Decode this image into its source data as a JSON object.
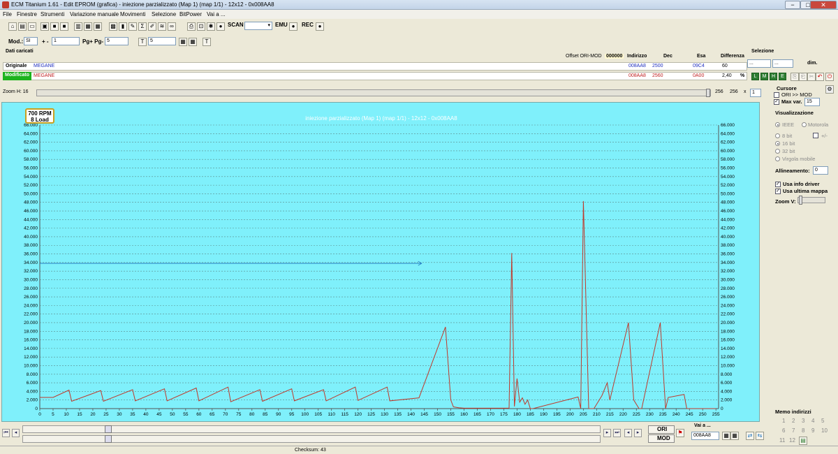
{
  "window": {
    "title": "ECM Titanium 1.61 - Edit EPROM (grafica) - iniezione parzializzato (Map 1) (map 1/1) - 12x12 - 0x008AA8",
    "minimize": "−",
    "maximize": "□",
    "close": "✕"
  },
  "menu": [
    "File",
    "Finestre",
    "Strumenti",
    "Variazione manuale",
    "Movimenti",
    "Selezione",
    "BitPower",
    "Vai a ..."
  ],
  "toolbar": {
    "scan_label": "SCAN",
    "emu_label": "EMU",
    "rec_label": "REC",
    "mod_label": "Mod.:",
    "mod_value": "SI",
    "plusminus_label": "+ -",
    "step_value": "1",
    "pg_label": "Pg+ Pg-",
    "pg_value": "5",
    "t_value": "5"
  },
  "data_panel": {
    "header": "Dati caricati",
    "offset_label": "Offset ORI-MOD",
    "offset_value": "000000",
    "col_indirizzo": "Indirizzo",
    "col_dec": "Dec",
    "col_esa": "Esa",
    "col_differenza": "Differenza",
    "originale_label": "Originale",
    "originale_name": "MEGANE",
    "originale_addr": "008AA8",
    "originale_dec": "2500",
    "originale_esa": "09C4",
    "originale_diff": "60",
    "modificato_label": "Modificato",
    "modificato_name": "MEGANE",
    "modificato_addr": "008AA8",
    "modificato_dec": "2560",
    "modificato_esa": "0A00",
    "modificato_diff": "2,40",
    "percent": "%"
  },
  "selezione": {
    "title": "Selezione",
    "from": "...",
    "to": "...",
    "dim_label": "dim."
  },
  "zoom": {
    "label": "Zoom H: 16",
    "value1": "256",
    "value2": "256",
    "mult": "x",
    "factor": "1"
  },
  "cursor_tag": {
    "rpm": "700 RPM",
    "load": "8 Load"
  },
  "right_panel": {
    "cursore_title": "Cursore",
    "ori_mod": "ORI >> MOD",
    "max_var_label": "Max var.",
    "max_var_value": "15",
    "visualizzazione_title": "Visualizzazione",
    "ieee": "IEEE",
    "motorola": "Motorola",
    "bit8": "8 bit",
    "plusminus": "+/-",
    "bit16": "16 bit",
    "bit32": "32 bit",
    "virgola": "Virgola mobile",
    "allineamento_label": "Allineamento:",
    "allineamento_value": "0",
    "usa_info": "Usa info driver",
    "usa_ultima": "Usa ultima mappa",
    "zoom_v": "Zoom V:",
    "memo_title": "Memo indirizzi",
    "memo": [
      "1",
      "2",
      "3",
      "4",
      "5",
      "6",
      "7",
      "8",
      "9",
      "10",
      "11",
      "12"
    ]
  },
  "bottom": {
    "ori_btn": "ORI",
    "mod_btn": "MOD",
    "vai_a_label": "Vai a ...",
    "vai_a_value": "008AA8",
    "checksum": "Checksum: 43"
  },
  "colors": {
    "plot_bg": "#7ff0fb",
    "series_line": "#c0392b",
    "cursor_line": "#1e73be",
    "modificato_green": "#1db31d"
  },
  "chart_data": {
    "type": "line",
    "title": "iniezione parzializzato (Map 1) (map 1/1) - 12x12 - 0x008AA8",
    "xlim": [
      0,
      256
    ],
    "ylim": [
      0,
      66000
    ],
    "x_ticks": [
      0,
      5,
      10,
      15,
      20,
      25,
      30,
      35,
      40,
      45,
      50,
      55,
      60,
      65,
      70,
      75,
      80,
      85,
      90,
      95,
      100,
      105,
      110,
      115,
      120,
      125,
      130,
      135,
      140,
      145,
      150,
      155,
      160,
      165,
      170,
      175,
      180,
      185,
      190,
      195,
      200,
      205,
      210,
      215,
      220,
      225,
      230,
      235,
      240,
      245,
      250,
      255
    ],
    "y_ticks": [
      "0",
      "2.000",
      "4.000",
      "6.000",
      "8.000",
      "10.000",
      "12.000",
      "14.000",
      "16.000",
      "18.000",
      "20.000",
      "22.000",
      "24.000",
      "26.000",
      "28.000",
      "30.000",
      "32.000",
      "34.000",
      "36.000",
      "38.000",
      "40.000",
      "42.000",
      "44.000",
      "46.000",
      "48.000",
      "50.000",
      "52.000",
      "54.000",
      "56.000",
      "58.000",
      "60.000",
      "62.000",
      "64.000",
      "66.000"
    ],
    "grid": true,
    "series": [
      {
        "points": [
          [
            0,
            2600
          ],
          [
            5,
            2600
          ],
          [
            11,
            4300
          ],
          [
            12,
            1700
          ],
          [
            23,
            4200
          ],
          [
            24,
            1700
          ],
          [
            35,
            4400
          ],
          [
            36,
            1800
          ],
          [
            47,
            4600
          ],
          [
            48,
            1800
          ],
          [
            59,
            4800
          ],
          [
            60,
            1800
          ],
          [
            71,
            5000
          ],
          [
            72,
            1600
          ],
          [
            83,
            4400
          ],
          [
            84,
            1700
          ],
          [
            95,
            4600
          ],
          [
            96,
            1800
          ],
          [
            107,
            4400
          ],
          [
            108,
            1800
          ],
          [
            119,
            5000
          ],
          [
            120,
            1900
          ],
          [
            131,
            5000
          ],
          [
            132,
            1800
          ],
          [
            143,
            2500
          ],
          [
            153,
            19000
          ],
          [
            155,
            2000
          ],
          [
            156,
            400
          ],
          [
            158,
            200
          ],
          [
            160,
            100
          ],
          [
            177,
            100
          ],
          [
            178,
            36200
          ],
          [
            179,
            500
          ],
          [
            180,
            7000
          ],
          [
            181,
            1500
          ],
          [
            182,
            2500
          ],
          [
            183,
            1000
          ],
          [
            184,
            2000
          ],
          [
            185,
            0
          ],
          [
            186,
            0
          ],
          [
            203,
            2700
          ],
          [
            204,
            0
          ],
          [
            205,
            48300
          ],
          [
            207,
            0
          ],
          [
            209,
            0
          ],
          [
            212,
            3000
          ],
          [
            214,
            6000
          ],
          [
            215,
            2000
          ],
          [
            222,
            20000
          ],
          [
            224,
            2000
          ],
          [
            226,
            0
          ],
          [
            227,
            0
          ],
          [
            234,
            20000
          ],
          [
            236,
            0
          ],
          [
            237,
            2600
          ],
          [
            243,
            3300
          ],
          [
            244,
            0
          ],
          [
            255,
            0
          ]
        ]
      },
      {
        "points": [
          [
            0,
            33800
          ],
          [
            144,
            33800
          ]
        ]
      }
    ]
  }
}
